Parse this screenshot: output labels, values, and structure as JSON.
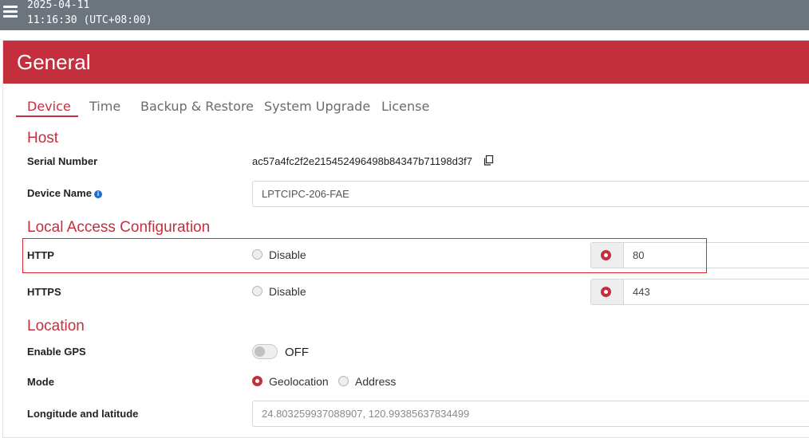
{
  "topbar": {
    "date": "2025-04-11",
    "time": "11:16:30 (UTC+08:00)",
    "menu_icon": "hamburger-menu-icon"
  },
  "card": {
    "title": "General"
  },
  "tabs": [
    {
      "label": "Device",
      "active": true
    },
    {
      "label": "Time",
      "active": false
    },
    {
      "label": "Backup & Restore",
      "active": false
    },
    {
      "label": "System Upgrade",
      "active": false
    },
    {
      "label": "License",
      "active": false
    }
  ],
  "host": {
    "title": "Host",
    "serial_label": "Serial Number",
    "serial_value": "ac57a4fc2f2e215452496498b84347b71198d3f7",
    "copy_icon": "copy-icon",
    "device_name_label": "Device Name",
    "info_icon": "info-icon",
    "device_name_value": "LPTCIPC-206-FAE"
  },
  "local_access": {
    "title": "Local Access Configuration",
    "http": {
      "label": "HTTP",
      "disable_label": "Disable",
      "port": "80"
    },
    "https": {
      "label": "HTTPS",
      "disable_label": "Disable",
      "port": "443"
    }
  },
  "location": {
    "title": "Location",
    "gps_label": "Enable GPS",
    "gps_state": "OFF",
    "mode_label": "Mode",
    "mode_options": [
      "Geolocation",
      "Address"
    ],
    "mode_selected": "Geolocation",
    "lnglat_label": "Longitude and latitude",
    "lnglat_placeholder": "24.803259937088907, 120.99385637834499"
  },
  "colors": {
    "brand": "#c42f3d",
    "topbar": "#6c757d",
    "highlight": "#e0232e"
  }
}
